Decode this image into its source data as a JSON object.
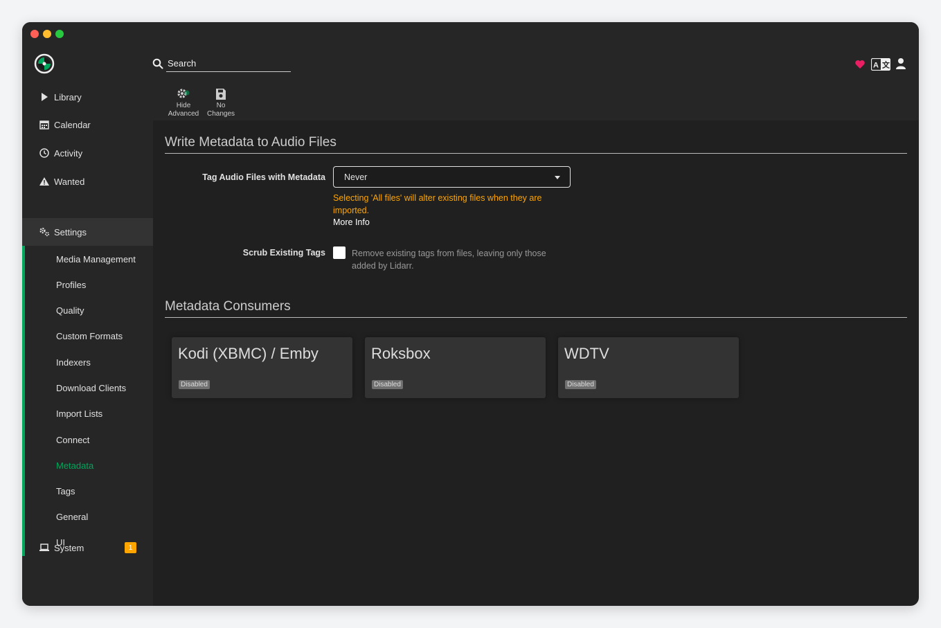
{
  "header": {
    "search_placeholder": "Search",
    "icons": [
      "logo-icon",
      "search-icon",
      "heart-icon",
      "translate-icon",
      "user-icon"
    ]
  },
  "sidebar": {
    "items": [
      {
        "label": "Library",
        "icon": "play-icon"
      },
      {
        "label": "Calendar",
        "icon": "calendar-icon"
      },
      {
        "label": "Activity",
        "icon": "clock-icon"
      },
      {
        "label": "Wanted",
        "icon": "warning-icon"
      },
      {
        "label": "Settings",
        "icon": "cogs-icon"
      },
      {
        "label": "System",
        "icon": "laptop-icon",
        "badge": "1"
      }
    ],
    "settings_items": [
      "Media Management",
      "Profiles",
      "Quality",
      "Custom Formats",
      "Indexers",
      "Download Clients",
      "Import Lists",
      "Connect",
      "Metadata",
      "Tags",
      "General",
      "UI"
    ],
    "current": "Metadata"
  },
  "toolbar": {
    "hide_advanced": {
      "line1": "Hide",
      "line2": "Advanced"
    },
    "no_changes": {
      "line1": "No",
      "line2": "Changes"
    }
  },
  "write_metadata": {
    "title": "Write Metadata to Audio Files",
    "tag_label": "Tag Audio Files with Metadata",
    "tag_value": "Never",
    "warning": "Selecting 'All files' will alter existing files when they are imported.",
    "more_info": "More Info",
    "scrub_label": "Scrub Existing Tags",
    "scrub_checked": false,
    "scrub_help": "Remove existing tags from files, leaving only those added by Lidarr."
  },
  "consumers": {
    "title": "Metadata Consumers",
    "cards": [
      {
        "name": "Kodi (XBMC) / Emby",
        "status": "Disabled"
      },
      {
        "name": "Roksbox",
        "status": "Disabled"
      },
      {
        "name": "WDTV",
        "status": "Disabled"
      }
    ]
  },
  "colors": {
    "accent": "#00a65b",
    "warning": "#ffa500",
    "heart": "#e91e63",
    "background": "#202020",
    "panel": "#262626"
  }
}
